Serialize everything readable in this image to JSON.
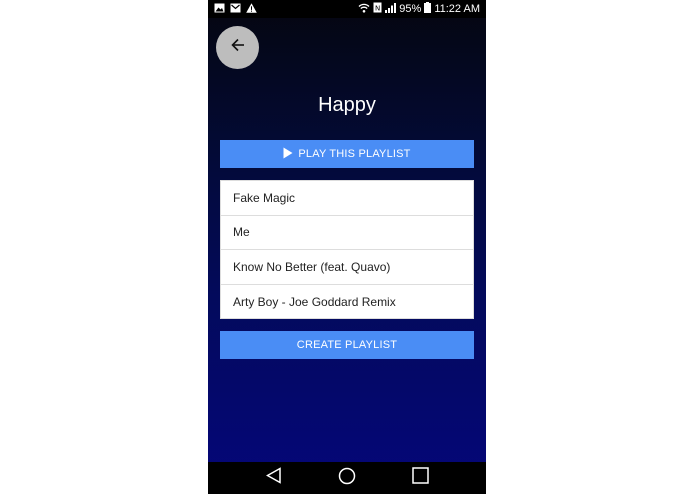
{
  "status_bar": {
    "battery_percent": "95%",
    "time": "11:22 AM",
    "left_icons": [
      "image-icon",
      "mail-icon",
      "warning-icon"
    ],
    "right_icons": [
      "wifi-icon",
      "nfc-icon",
      "signal-icon",
      "battery-icon"
    ]
  },
  "header": {
    "back_icon": "arrow-left-icon",
    "title": "Happy"
  },
  "play_button": {
    "icon": "play-icon",
    "label": "PLAY THIS PLAYLIST"
  },
  "tracks": [
    {
      "title": "Fake Magic"
    },
    {
      "title": "Me"
    },
    {
      "title": "Know No Better (feat. Quavo)"
    },
    {
      "title": "Arty Boy - Joe Goddard Remix"
    }
  ],
  "create_button": {
    "label": "CREATE PLAYLIST"
  },
  "nav_bar": {
    "icons": [
      "back-triangle-icon",
      "home-circle-icon",
      "recents-square-icon"
    ]
  },
  "colors": {
    "accent": "#4a8df5",
    "back_button": "#bdbdbd"
  }
}
